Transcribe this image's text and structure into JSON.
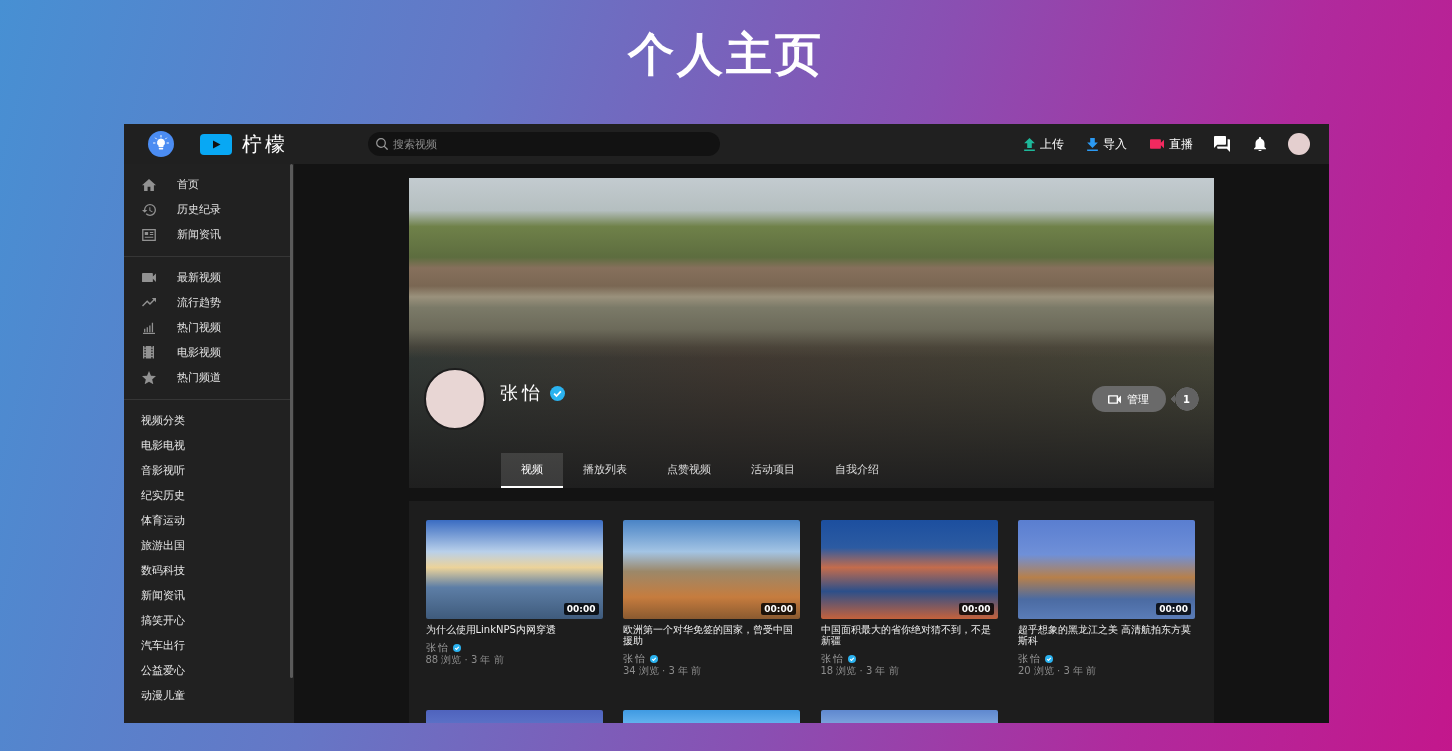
{
  "page_title": "个人主页",
  "topbar": {
    "brand": "柠檬",
    "search": {
      "placeholder": "搜索视频"
    },
    "actions": [
      {
        "kind": "upload",
        "label": "上传"
      },
      {
        "kind": "import",
        "label": "导入"
      },
      {
        "kind": "live",
        "label": "直播"
      }
    ]
  },
  "sidebar": {
    "groups": [
      {
        "items": [
          {
            "kind": "home",
            "label": "首页"
          },
          {
            "kind": "history",
            "label": "历史纪录"
          },
          {
            "kind": "news",
            "label": "新闻资讯"
          }
        ]
      },
      {
        "items": [
          {
            "kind": "camera",
            "label": "最新视频"
          },
          {
            "kind": "trending",
            "label": "流行趋势"
          },
          {
            "kind": "chart",
            "label": "热门视频"
          },
          {
            "kind": "film",
            "label": "电影视频"
          },
          {
            "kind": "star",
            "label": "热门频道"
          }
        ]
      }
    ],
    "categories": {
      "heading": "视频分类",
      "items": [
        "电影电视",
        "音影视听",
        "纪实历史",
        "体育运动",
        "旅游出国",
        "数码科技",
        "新闻资讯",
        "搞笑开心",
        "汽车出行",
        "公益爱心",
        "动漫儿童"
      ]
    }
  },
  "profile": {
    "name": "张怡",
    "verified": true,
    "manage_button": "管理",
    "notification_count": "1",
    "tabs": [
      {
        "label": "视频",
        "selected": true
      },
      {
        "label": "播放列表",
        "selected": false
      },
      {
        "label": "点赞视频",
        "selected": false
      },
      {
        "label": "活动项目",
        "selected": false
      },
      {
        "label": "自我介绍",
        "selected": false
      }
    ]
  },
  "videos": [
    {
      "kind": "full",
      "title": "为什么使用LinkNPS内网穿透",
      "duration": "00:00",
      "author": "张怡",
      "verified": true,
      "stats": "88 浏览 · 3 年 前"
    },
    {
      "kind": "full",
      "title": "欧洲第一个对华免签的国家，曾受中国援助",
      "duration": "00:00",
      "author": "张怡",
      "verified": true,
      "stats": "34 浏览 · 3 年 前"
    },
    {
      "kind": "full",
      "title": "中国面积最大的省你绝对猜不到，不是新疆",
      "duration": "00:00",
      "author": "张怡",
      "verified": true,
      "stats": "18 浏览 · 3 年 前"
    },
    {
      "kind": "full",
      "title": "超乎想象的黑龙江之美 高清航拍东方莫斯科",
      "duration": "00:00",
      "author": "张怡",
      "verified": true,
      "stats": "20 浏览 · 3 年 前"
    },
    {
      "kind": "cut"
    },
    {
      "kind": "cut"
    },
    {
      "kind": "cut"
    }
  ]
}
